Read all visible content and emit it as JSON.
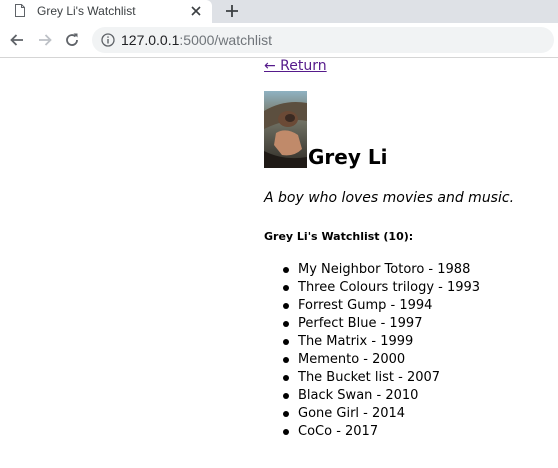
{
  "browser": {
    "tab_title": "Grey Li's Watchlist",
    "url_host": "127.0.0.1",
    "url_path": ":5000/watchlist"
  },
  "page": {
    "return_link": "← Return",
    "user_name": "Grey Li",
    "bio": "A boy who loves movies and music.",
    "watchlist_heading": "Grey Li's Watchlist (10):",
    "movies": [
      "My Neighbor Totoro - 1988",
      "Three Colours trilogy - 1993",
      "Forrest Gump - 1994",
      "Perfect Blue - 1997",
      "The Matrix - 1999",
      "Memento - 2000",
      "The Bucket list - 2007",
      "Black Swan - 2010",
      "Gone Girl - 2014",
      "CoCo - 2017"
    ]
  }
}
